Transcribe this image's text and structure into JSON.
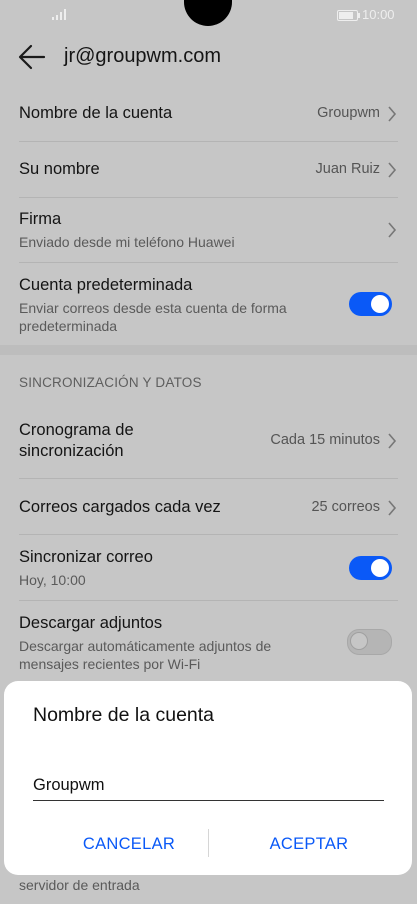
{
  "status": {
    "time": "10:00"
  },
  "header": {
    "title": "jr@groupwm.com"
  },
  "settings": {
    "account_name": {
      "label": "Nombre de la cuenta",
      "value": "Groupwm"
    },
    "your_name": {
      "label": "Su nombre",
      "value": "Juan Ruiz"
    },
    "signature": {
      "label": "Firma",
      "sub": "Enviado desde mi teléfono Huawei"
    },
    "default_account": {
      "label": "Cuenta predeterminada",
      "sub": "Enviar correos desde esta cuenta de forma predeterminada",
      "enabled": true
    }
  },
  "sync": {
    "section_title": "SINCRONIZACIÓN Y DATOS",
    "schedule": {
      "label": "Cronograma de sincronización",
      "value": "Cada 15 minutos"
    },
    "load_count": {
      "label": "Correos cargados cada vez",
      "value": "25 correos"
    },
    "sync_mail": {
      "label": "Sincronizar correo",
      "sub": "Hoy, 10:00",
      "enabled": true
    },
    "download_attachments": {
      "label": "Descargar adjuntos",
      "sub": "Descargar automáticamente adjuntos de mensajes recientes por Wi-Fi",
      "enabled": false
    },
    "incoming_server": "servidor de entrada"
  },
  "dialog": {
    "title": "Nombre de la cuenta",
    "input_value": "Groupwm",
    "cancel_label": "CANCELAR",
    "ok_label": "ACEPTAR"
  },
  "colors": {
    "accent": "#0a59f7"
  }
}
